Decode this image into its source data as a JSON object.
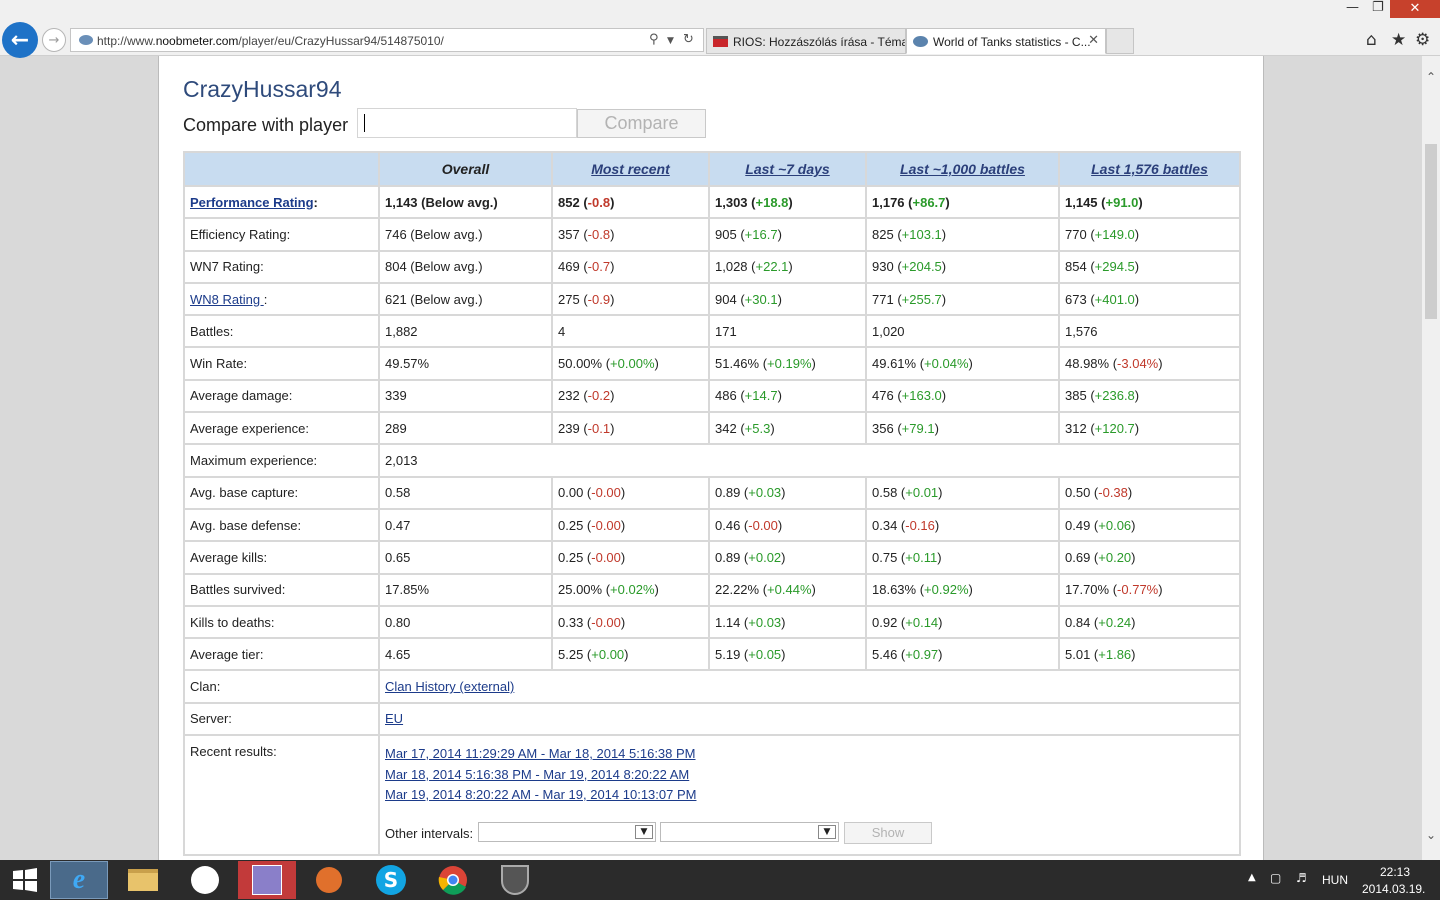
{
  "browser": {
    "url_prefix": "http://www.",
    "url_domain": "noobmeter.com",
    "url_path": "/player/eu/CrazyHussar94/514875010/",
    "tabs": [
      {
        "title": "RIOS: Hozzászólás írása - Téma..."
      },
      {
        "title": "World of Tanks statistics - C..."
      }
    ]
  },
  "player": {
    "name": "CrazyHussar94",
    "compare_label": "Compare with player",
    "compare_value": "",
    "compare_button": "Compare"
  },
  "table": {
    "headers": [
      "Overall",
      "Most recent",
      "Last ~7 days",
      "Last ~1,000 battles",
      "Last 1,576 battles"
    ],
    "rows": [
      {
        "label": "Performance Rating",
        "label_suffix": ":",
        "values": [
          {
            "v": "1,143 (Below avg.)"
          },
          {
            "v": "852",
            "d": "-0.8",
            "s": "neg"
          },
          {
            "v": "1,303",
            "d": "+18.8",
            "s": "pos"
          },
          {
            "v": "1,176",
            "d": "+86.7",
            "s": "pos"
          },
          {
            "v": "1,145",
            "d": "+91.0",
            "s": "pos"
          }
        ]
      },
      {
        "label": "Efficiency Rating:",
        "values": [
          {
            "v": "746 (Below avg.)"
          },
          {
            "v": "357",
            "d": "-0.8",
            "s": "neg"
          },
          {
            "v": "905",
            "d": "+16.7",
            "s": "pos"
          },
          {
            "v": "825",
            "d": "+103.1",
            "s": "pos"
          },
          {
            "v": "770",
            "d": "+149.0",
            "s": "pos"
          }
        ]
      },
      {
        "label": "WN7 Rating:",
        "values": [
          {
            "v": "804 (Below avg.)"
          },
          {
            "v": "469",
            "d": "-0.7",
            "s": "neg"
          },
          {
            "v": "1,028",
            "d": "+22.1",
            "s": "pos"
          },
          {
            "v": "930",
            "d": "+204.5",
            "s": "pos"
          },
          {
            "v": "854",
            "d": "+294.5",
            "s": "pos"
          }
        ]
      },
      {
        "label": "WN8 Rating ",
        "label_suffix": ":",
        "values": [
          {
            "v": "621 (Below avg.)"
          },
          {
            "v": "275",
            "d": "-0.9",
            "s": "neg"
          },
          {
            "v": "904",
            "d": "+30.1",
            "s": "pos"
          },
          {
            "v": "771",
            "d": "+255.7",
            "s": "pos"
          },
          {
            "v": "673",
            "d": "+401.0",
            "s": "pos"
          }
        ]
      },
      {
        "label": "Battles:",
        "values": [
          {
            "v": "1,882"
          },
          {
            "v": "4"
          },
          {
            "v": "171"
          },
          {
            "v": "1,020"
          },
          {
            "v": "1,576"
          }
        ]
      },
      {
        "label": "Win Rate:",
        "values": [
          {
            "v": "49.57%"
          },
          {
            "v": "50.00%",
            "d": "+0.00%",
            "s": "pos"
          },
          {
            "v": "51.46%",
            "d": "+0.19%",
            "s": "pos"
          },
          {
            "v": "49.61%",
            "d": "+0.04%",
            "s": "pos"
          },
          {
            "v": "48.98%",
            "d": "-3.04%",
            "s": "neg"
          }
        ]
      },
      {
        "label": "Average damage:",
        "values": [
          {
            "v": "339"
          },
          {
            "v": "232",
            "d": "-0.2",
            "s": "neg"
          },
          {
            "v": "486",
            "d": "+14.7",
            "s": "pos"
          },
          {
            "v": "476",
            "d": "+163.0",
            "s": "pos"
          },
          {
            "v": "385",
            "d": "+236.8",
            "s": "pos"
          }
        ]
      },
      {
        "label": "Average experience:",
        "values": [
          {
            "v": "289"
          },
          {
            "v": "239",
            "d": "-0.1",
            "s": "neg"
          },
          {
            "v": "342",
            "d": "+5.3",
            "s": "pos"
          },
          {
            "v": "356",
            "d": "+79.1",
            "s": "pos"
          },
          {
            "v": "312",
            "d": "+120.7",
            "s": "pos"
          }
        ]
      },
      {
        "label": "Maximum experience:",
        "span_value": "2,013"
      },
      {
        "label": "Avg. base capture:",
        "values": [
          {
            "v": "0.58"
          },
          {
            "v": "0.00",
            "d": "-0.00",
            "s": "neg"
          },
          {
            "v": "0.89",
            "d": "+0.03",
            "s": "pos"
          },
          {
            "v": "0.58",
            "d": "+0.01",
            "s": "pos"
          },
          {
            "v": "0.50",
            "d": "-0.38",
            "s": "neg"
          }
        ]
      },
      {
        "label": "Avg. base defense:",
        "values": [
          {
            "v": "0.47"
          },
          {
            "v": "0.25",
            "d": "-0.00",
            "s": "neg"
          },
          {
            "v": "0.46",
            "d": "-0.00",
            "s": "neg"
          },
          {
            "v": "0.34",
            "d": "-0.16",
            "s": "neg"
          },
          {
            "v": "0.49",
            "d": "+0.06",
            "s": "pos"
          }
        ]
      },
      {
        "label": "Average kills:",
        "values": [
          {
            "v": "0.65"
          },
          {
            "v": "0.25",
            "d": "-0.00",
            "s": "neg"
          },
          {
            "v": "0.89",
            "d": "+0.02",
            "s": "pos"
          },
          {
            "v": "0.75",
            "d": "+0.11",
            "s": "pos"
          },
          {
            "v": "0.69",
            "d": "+0.20",
            "s": "pos"
          }
        ]
      },
      {
        "label": "Battles survived:",
        "values": [
          {
            "v": "17.85%"
          },
          {
            "v": "25.00%",
            "d": "+0.02%",
            "s": "pos"
          },
          {
            "v": "22.22%",
            "d": "+0.44%",
            "s": "pos"
          },
          {
            "v": "18.63%",
            "d": "+0.92%",
            "s": "pos"
          },
          {
            "v": "17.70%",
            "d": "-0.77%",
            "s": "neg"
          }
        ]
      },
      {
        "label": "Kills to deaths:",
        "values": [
          {
            "v": "0.80"
          },
          {
            "v": "0.33",
            "d": "-0.00",
            "s": "neg"
          },
          {
            "v": "1.14",
            "d": "+0.03",
            "s": "pos"
          },
          {
            "v": "0.92",
            "d": "+0.14",
            "s": "pos"
          },
          {
            "v": "0.84",
            "d": "+0.24",
            "s": "pos"
          }
        ]
      },
      {
        "label": "Average tier:",
        "values": [
          {
            "v": "4.65"
          },
          {
            "v": "5.25",
            "d": "+0.00",
            "s": "pos"
          },
          {
            "v": "5.19",
            "d": "+0.05",
            "s": "pos"
          },
          {
            "v": "5.46",
            "d": "+0.97",
            "s": "pos"
          },
          {
            "v": "5.01",
            "d": "+1.86",
            "s": "pos"
          }
        ]
      },
      {
        "label": "Clan:",
        "span_link": "Clan History (external)"
      },
      {
        "label": "Server:",
        "span_link": "EU"
      }
    ],
    "recent": {
      "label": "Recent results:",
      "links": [
        "Mar 17, 2014 11:29:29 AM - Mar 18, 2014 5:16:38 PM",
        "Mar 18, 2014 5:16:38 PM - Mar 19, 2014 8:20:22 AM",
        "Mar 19, 2014 8:20:22 AM - Mar 19, 2014 10:13:07 PM"
      ],
      "other_label": "Other intervals:",
      "show_button": "Show"
    }
  },
  "taskbar": {
    "apps": [
      "windows-start-icon",
      "internet-explorer-icon",
      "file-explorer-icon",
      "steam-icon",
      "anime-app-icon",
      "media-player-icon",
      "skype-icon",
      "chrome-icon",
      "world-of-tanks-icon"
    ],
    "language": "HUN",
    "time": "22:13",
    "date": "2014.03.19."
  }
}
